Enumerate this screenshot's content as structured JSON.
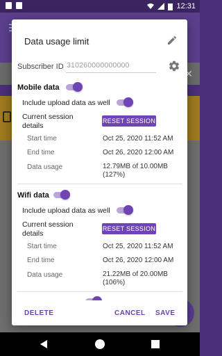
{
  "status_bar": {
    "time": "12:31"
  },
  "dialog": {
    "title": "Data usage limit",
    "subscriber_label": "Subscriber ID",
    "subscriber_value": "310260000000000",
    "mobile": {
      "title": "Mobile data",
      "enabled": true,
      "include_upload_label": "Include upload data as well",
      "include_upload": true,
      "session_label": "Current session details",
      "reset_label": "RESET SESSION",
      "start_label": "Start time",
      "start_value": "Oct 25, 2020 11:52 AM",
      "end_label": "End time",
      "end_value": "Oct 26, 2020 12:00 AM",
      "usage_label": "Data usage",
      "usage_value": "12.79MB of 10.00MB (127%)"
    },
    "wifi": {
      "title": "Wifi data",
      "enabled": true,
      "include_upload_label": "Include upload data as well",
      "include_upload": true,
      "session_label": "Current session details",
      "reset_label": "RESET SESSION",
      "start_label": "Start time",
      "start_value": "Oct 25, 2020 11:52 AM",
      "end_label": "End time",
      "end_value": "Oct 26, 2020 12:00 AM",
      "usage_label": "Data usage",
      "usage_value": "21.22MB of 20.00MB (106%)"
    },
    "actions": {
      "delete": "DELETE",
      "cancel": "CANCEL",
      "save": "SAVE"
    }
  },
  "colors": {
    "accent": "#6f45b5",
    "toolbar": "#5b3f8c"
  }
}
